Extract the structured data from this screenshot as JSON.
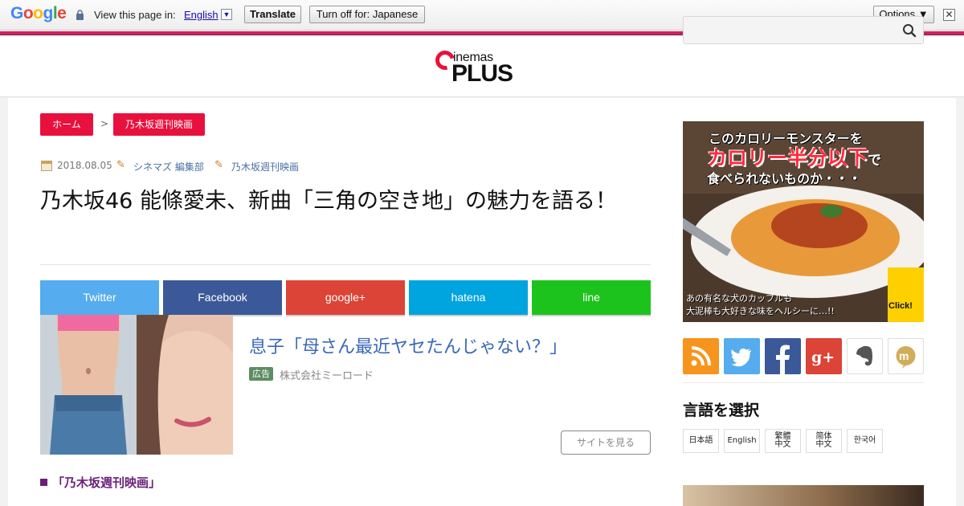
{
  "translate_bar": {
    "brand": "Google",
    "prompt": "View this page in:",
    "language": "English",
    "dropdown_glyph": "▼",
    "translate_label": "Translate",
    "turn_off_label": "Turn off for: Japanese",
    "options_label": "Options ▼",
    "close_glyph": "✕",
    "brand_colors": [
      "#4285f4",
      "#ea4335",
      "#fbbc05",
      "#4285f4",
      "#34a853",
      "#ea4335"
    ]
  },
  "site": {
    "logo_top": "inemas",
    "logo_bottom": "PLUS",
    "brand_color": "#e8113d",
    "accent_stripe": "#cf2061",
    "search_value": "",
    "search_icon": "search-icon"
  },
  "breadcrumb": {
    "home": "ホーム",
    "separator": ">",
    "category": "乃木坂週刊映画"
  },
  "article": {
    "date": "2018.08.05",
    "author": "シネマズ 編集部",
    "category": "乃木坂週刊映画",
    "title": "乃木坂46 能條愛未、新曲「三角の空き地」の魅力を語る！",
    "section_heading": "「乃木坂週刊映画」"
  },
  "share": [
    {
      "label": "Twitter",
      "color": "#55acee"
    },
    {
      "label": "Facebook",
      "color": "#3b5998"
    },
    {
      "label": "google+",
      "color": "#db4437"
    },
    {
      "label": "hatena",
      "color": "#00a4de"
    },
    {
      "label": "line",
      "color": "#1dc31d"
    }
  ],
  "ad": {
    "headline": "息子「母さん最近ヤセたんじゃない？」",
    "badge": "広告",
    "advertiser": "株式会社ミーロード",
    "cta": "サイトを見る"
  },
  "sidebar": {
    "banner": {
      "line1": "このカロリーモンスターを",
      "line2": "カロリー半分以下",
      "line2_suffix": "で",
      "line3": "食べられないものか・・・",
      "foot1": "あの有名な犬のカップルも",
      "foot2": "大泥棒も大好きな味をヘルシーに…!!",
      "click": "Click!"
    },
    "social": [
      {
        "name": "rss-icon",
        "color": "#f7941d"
      },
      {
        "name": "twitter-icon",
        "color": "#55acee"
      },
      {
        "name": "facebook-icon",
        "color": "#3b5998"
      },
      {
        "name": "google-plus-icon",
        "color": "#db4437"
      },
      {
        "name": "evernote-icon",
        "color": "#ffffff"
      },
      {
        "name": "mixi-icon",
        "color": "#ffffff"
      }
    ],
    "language_heading": "言語を選択",
    "languages": [
      {
        "line1": "日本語",
        "line2": ""
      },
      {
        "line1": "English",
        "line2": ""
      },
      {
        "line1": "繁體",
        "line2": "中文"
      },
      {
        "line1": "简体",
        "line2": "中文"
      },
      {
        "line1": "한국어",
        "line2": ""
      }
    ]
  }
}
